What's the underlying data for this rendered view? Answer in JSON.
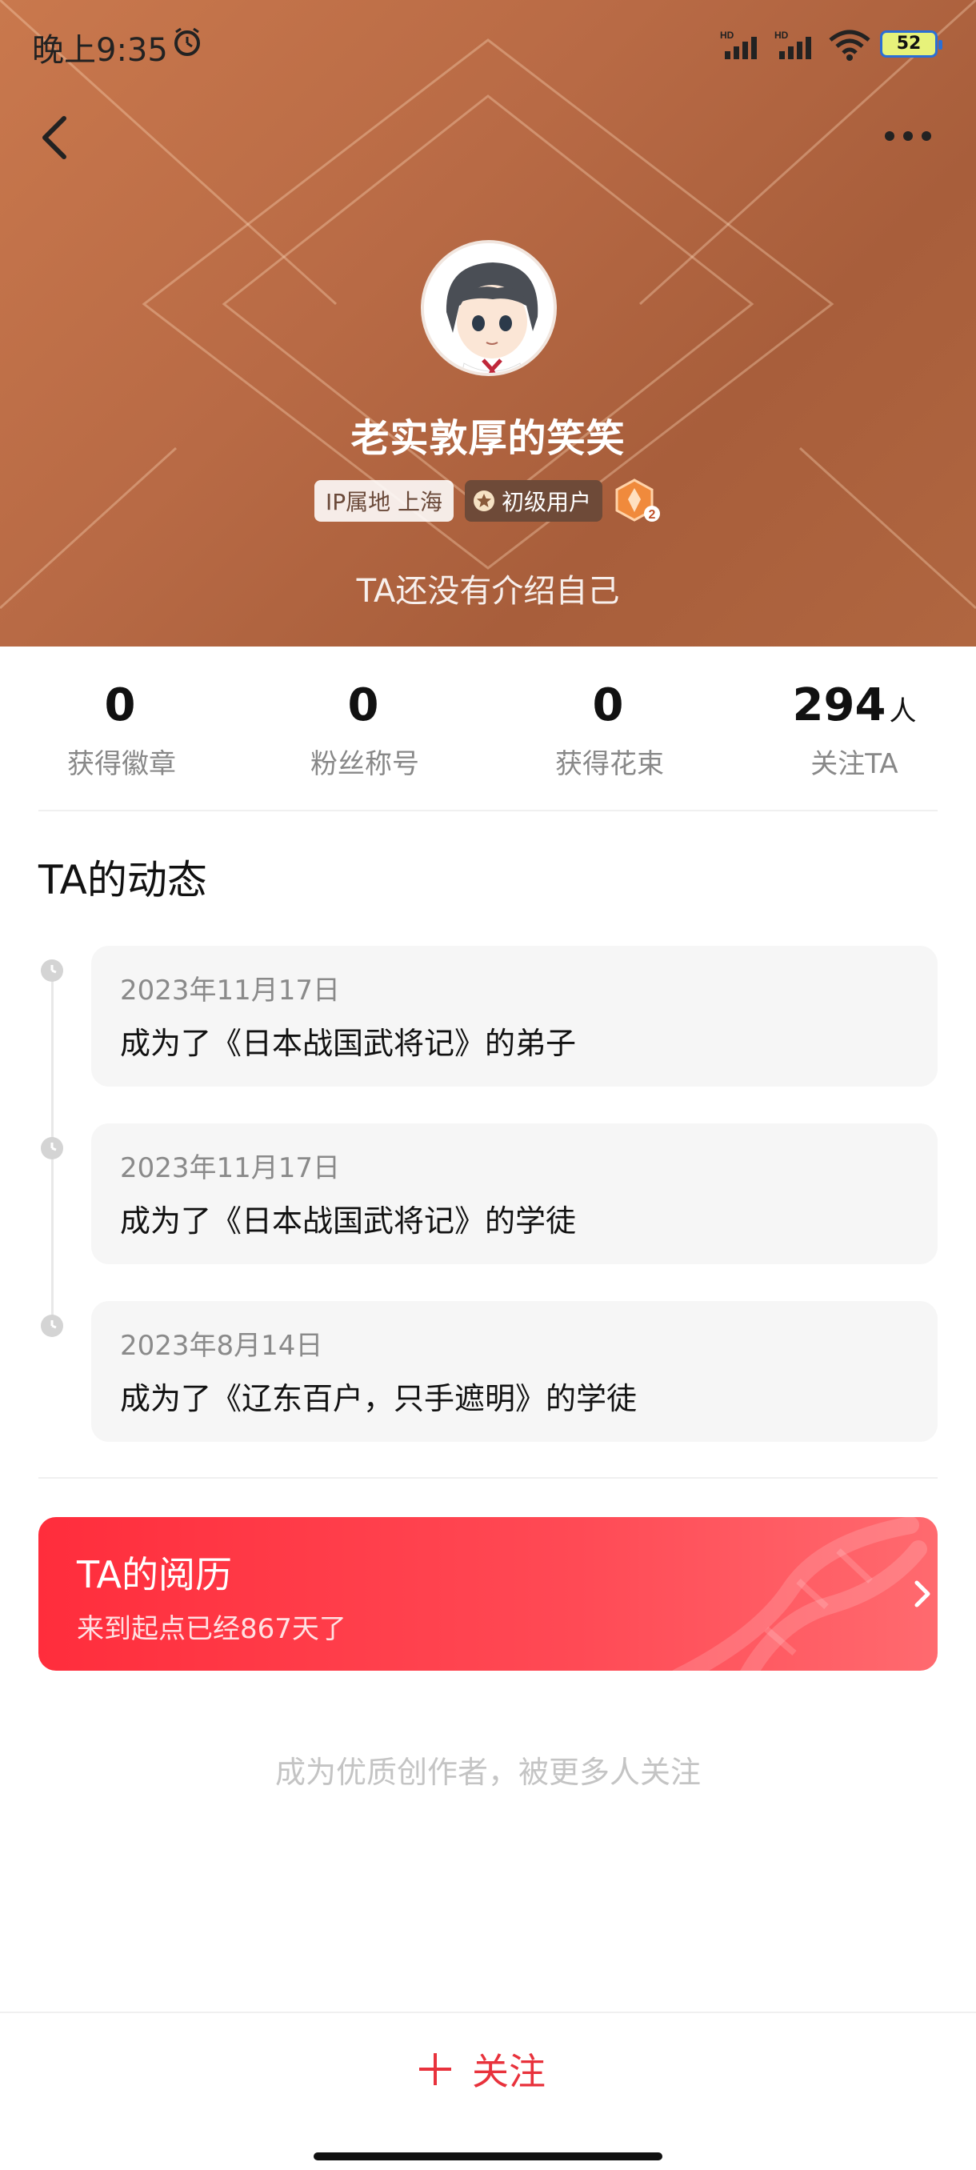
{
  "status_bar": {
    "time": "晚上9:35",
    "signal_1_label": "HD",
    "signal_2_label": "HD",
    "battery": "52"
  },
  "profile": {
    "nickname": "老实敦厚的笑笑",
    "ip_location": "IP属地 上海",
    "level_label": "初级用户",
    "medal_level": "2",
    "bio": "TA还没有介绍自己"
  },
  "stats": [
    {
      "value": "0",
      "unit": "",
      "label": "获得徽章"
    },
    {
      "value": "0",
      "unit": "",
      "label": "粉丝称号"
    },
    {
      "value": "0",
      "unit": "",
      "label": "获得花束"
    },
    {
      "value": "294",
      "unit": "人",
      "label": "关注TA"
    }
  ],
  "activity": {
    "title": "TA的动态",
    "items": [
      {
        "date": "2023年11月17日",
        "text": "成为了《日本战国武将记》的弟子"
      },
      {
        "date": "2023年11月17日",
        "text": "成为了《日本战国武将记》的学徒"
      },
      {
        "date": "2023年8月14日",
        "text": "成为了《辽东百户，只手遮明》的学徒"
      }
    ]
  },
  "experience": {
    "title": "TA的阅历",
    "subtitle": "来到起点已经867天了"
  },
  "promo_text": "成为优质创作者，被更多人关注",
  "follow_button": {
    "label": "关注"
  },
  "colors": {
    "banner": "#b86a45",
    "accent_red": "#e8323c",
    "card_bg": "#f6f6f6"
  }
}
